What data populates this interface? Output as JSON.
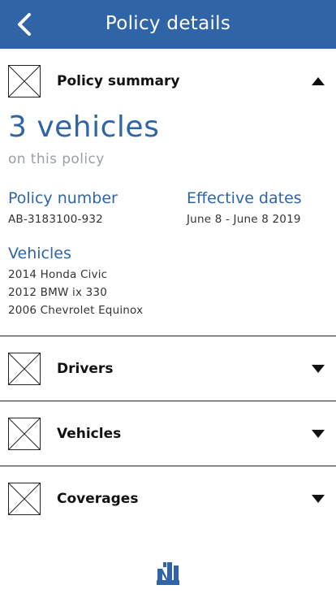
{
  "header": {
    "title": "Policy details"
  },
  "summary": {
    "section_label": "Policy summary",
    "vehicle_count": "3 vehicles",
    "vehicle_count_sub": "on this policy",
    "policy_number_label": "Policy number",
    "policy_number": "AB-3183100-932",
    "effective_dates_label": "Effective dates",
    "effective_dates": "June 8 - June 8 2019",
    "vehicles_label": "Vehicles",
    "vehicles": [
      "2014 Honda Civic",
      "2012 BMW ix 330",
      "2006 Chevrolet Equinox"
    ]
  },
  "sections": [
    {
      "label": "Drivers"
    },
    {
      "label": "Vehicles"
    },
    {
      "label": "Coverages"
    }
  ],
  "colors": {
    "brand": "#2f65a6",
    "muted": "#9aa0a6"
  },
  "icons": {
    "back": "chevron-left-icon",
    "expanded": "caret-up-icon",
    "collapsed": "caret-down-icon",
    "placeholder": "image-placeholder-icon",
    "logo": "company-logo"
  }
}
